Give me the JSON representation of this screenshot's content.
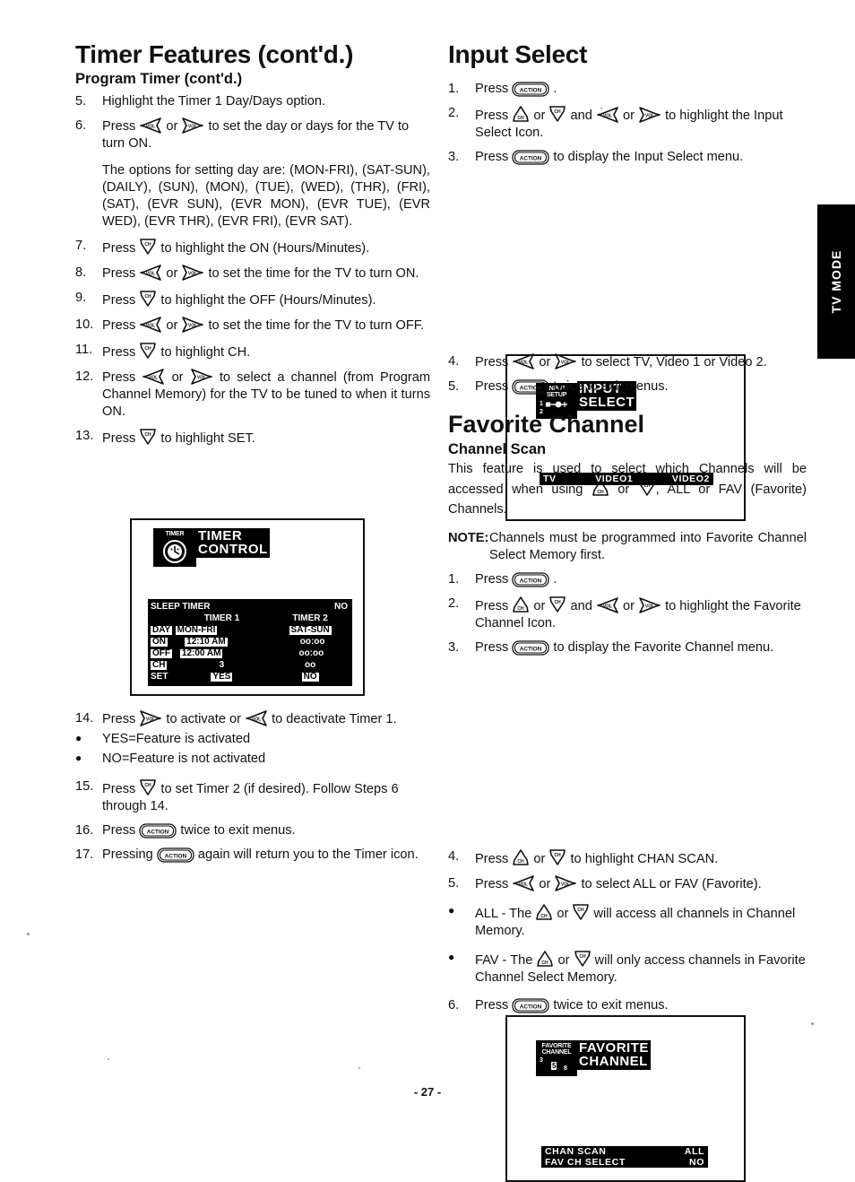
{
  "page": {
    "number": "- 27 -",
    "side_tab": "TV MODE"
  },
  "icons": {
    "ch_up": "ch-up-key-icon",
    "ch_down": "ch-down-key-icon",
    "vol_down": "vol-left-key-icon",
    "vol_up": "vol-right-key-icon",
    "action": "ACTION"
  },
  "left_column": {
    "title": "Timer Features (cont'd.)",
    "subtitle": "Program Timer (cont'd.)",
    "steps": [
      {
        "num": "5.",
        "text_before": "Highlight the Timer 1 Day/Days option."
      },
      {
        "num": "6.",
        "text_before": "Press ",
        "mid": " or ",
        "text_after": " to set the day or days for the TV to turn ON."
      }
    ],
    "options_para": "The options for setting day are: (MON-FRI), (SAT-SUN), (DAILY), (SUN), (MON), (TUE), (WED), (THR), (FRI), (SAT), (EVR SUN), (EVR MON), (EVR TUE), (EVR WED), (EVR THR), (EVR FRI), (EVR SAT).",
    "steps2": [
      {
        "num": "7.",
        "a": "Press ",
        "b": " to highlight the ON (Hours/Minutes)."
      },
      {
        "num": "8.",
        "a": "Press ",
        "b": " or ",
        "c": " to set the time for the TV to turn ON."
      },
      {
        "num": "9.",
        "a": "Press ",
        "b": " to highlight  the OFF (Hours/Minutes)."
      },
      {
        "num": "10.",
        "a": "Press ",
        "b": " or ",
        "c": " to set the time for the TV to turn OFF."
      },
      {
        "num": "11.",
        "a": "Press ",
        "b": " to highlight CH."
      },
      {
        "num": "12.",
        "a": "Press ",
        "b": " or ",
        "c": " to select a channel (from Program Channel Memory) for the TV to be tuned to when it turns ON."
      },
      {
        "num": "13.",
        "a": "Press ",
        "b": " to highlight SET."
      }
    ],
    "steps3": [
      {
        "num": "14.",
        "a": "Press ",
        "b": " to activate or ",
        "c": " to deactivate Timer 1."
      }
    ],
    "bullets": [
      "YES=Feature is activated",
      "NO=Feature is not activated"
    ],
    "steps4": [
      {
        "num": "15.",
        "a": "Press ",
        "b": " to set Timer 2 (if desired). Follow Steps 6 through 14."
      },
      {
        "num": "16.",
        "a": "Press ",
        "b": " twice to exit menus."
      },
      {
        "num": "17.",
        "a": "Pressing ",
        "b": " again will return you to the Timer icon."
      }
    ]
  },
  "timer_osd": {
    "icon_caption": "TIMER",
    "title": "TIMER\nCONTROL",
    "rows": [
      {
        "label": "SLEEP TIMER",
        "col1": "",
        "col2": "NO",
        "col2_inverted": false,
        "header": true
      },
      {
        "label": "",
        "col1": "TIMER 1",
        "col2": "TIMER 2",
        "header_row": true
      },
      {
        "label": "DAY",
        "col1": "MON-FRI",
        "col2": "SAT-SUN",
        "col1_inverted": true,
        "col2_inverted": true
      },
      {
        "label": "ON",
        "col1": "12:10 AM",
        "col2": "oo:oo",
        "col1_inverted": true
      },
      {
        "label": "OFF",
        "col1": "12:00 AM",
        "col2": "oo:oo",
        "col1_inverted": true
      },
      {
        "label": "CH",
        "col1": "3",
        "col2": "oo"
      },
      {
        "label": "SET",
        "col1": "YES",
        "col2": "NO",
        "col1_inverted": true,
        "col2_inverted": true
      }
    ]
  },
  "right_column": {
    "title": "Input Select",
    "steps": [
      {
        "num": "1.",
        "a": "Press ",
        "b": " ."
      },
      {
        "num": "2.",
        "a": "Press ",
        "b": " or ",
        "c": " and ",
        "d": " or ",
        "e": " to highlight the Input Select Icon."
      },
      {
        "num": "3.",
        "a": "Press ",
        "b": " to display the Input Select menu."
      }
    ],
    "steps_after": [
      {
        "num": "4.",
        "a": "Press ",
        "b": " or ",
        "c": " to select TV, Video 1 or Video 2."
      },
      {
        "num": "5.",
        "a": "Press ",
        "b": " twice to exit menus."
      }
    ],
    "title2": "Favorite Channel",
    "subtitle2": "Channel Scan",
    "intro_a": "This feature is used to select which Channels will be accessed when using ",
    "intro_b": " or ",
    "intro_c": ", ALL or FAV (Favorite) Channels.",
    "note_label": "NOTE:",
    "note_text": "Channels must be programmed into Favorite Channel Select Memory first.",
    "fav_steps": [
      {
        "num": "1.",
        "a": "Press ",
        "b": " ."
      },
      {
        "num": "2.",
        "a": "Press ",
        "b": " or ",
        "c": " and ",
        "d": " or ",
        "e": " to highlight the Favorite Channel Icon."
      },
      {
        "num": "3.",
        "a": "Press ",
        "b": " to display the Favorite Channel menu."
      }
    ],
    "fav_steps_after": [
      {
        "num": "4.",
        "a": "Press ",
        "b": " or ",
        "c": " to highlight CHAN SCAN."
      },
      {
        "num": "5.",
        "a": "Press ",
        "b": " or ",
        "c": " to select ALL or FAV (Favorite)."
      }
    ],
    "fav_bullets": [
      {
        "a": "ALL - The ",
        "b": " or ",
        "c": " will access all channels in Channel Memory."
      },
      {
        "a": "FAV - The ",
        "b": " or ",
        "c": " will only access channels in Favorite Channel Select Memory."
      }
    ],
    "fav_last": {
      "num": "6.",
      "a": "Press ",
      "b": " twice to exit menus."
    }
  },
  "input_osd": {
    "icon_caption": "INPUT\nSETUP",
    "icon_labels": [
      "1",
      "2"
    ],
    "title": "INPUT\nSELECT",
    "options": [
      "TV",
      "VIDEO1",
      "VIDEO2"
    ],
    "selected": "TV"
  },
  "favorite_osd": {
    "icon_caption": "FAVORITE\nCHANNEL",
    "icon_numbers": [
      "3",
      "5",
      "8"
    ],
    "title": "FAVORITE\nCHANNEL",
    "menu": [
      {
        "label": "CHAN SCAN",
        "value": "ALL"
      },
      {
        "label": "FAV CH SELECT",
        "value": "NO"
      }
    ]
  }
}
